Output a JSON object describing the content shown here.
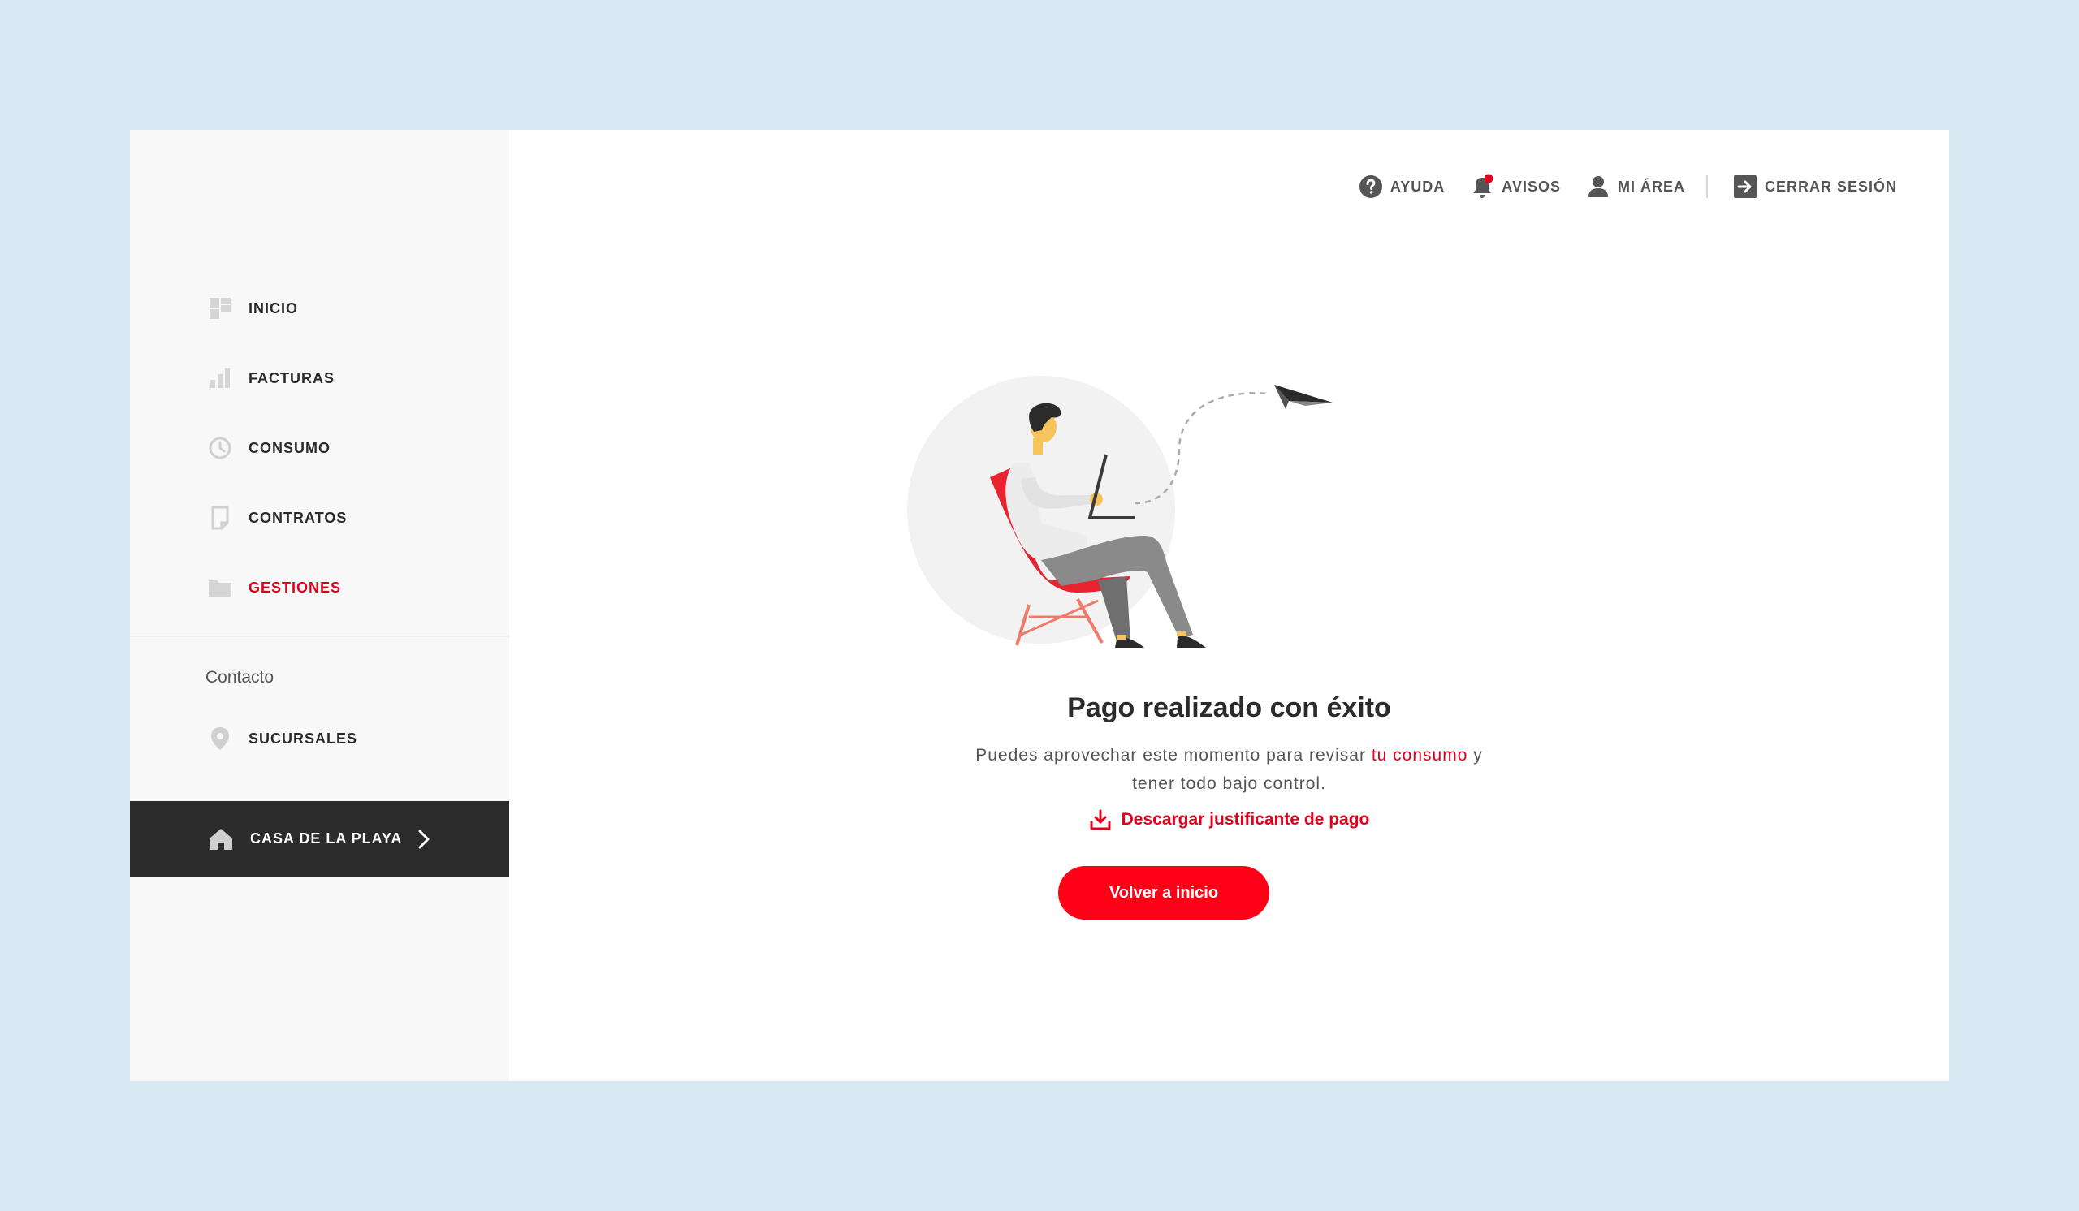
{
  "sidebar": {
    "items": [
      {
        "label": "INICIO",
        "icon": "dashboard-icon"
      },
      {
        "label": "FACTURAS",
        "icon": "bar-chart-icon"
      },
      {
        "label": "CONSUMO",
        "icon": "clock-icon"
      },
      {
        "label": "CONTRATOS",
        "icon": "document-icon"
      },
      {
        "label": "GESTIONES",
        "icon": "folder-icon",
        "active": true
      }
    ],
    "contact_title": "Contacto",
    "contact_items": [
      {
        "label": "SUCURSALES",
        "icon": "location-pin-icon"
      }
    ],
    "property": {
      "label": "CASA DE LA PLAYA",
      "icon": "home-icon"
    }
  },
  "topbar": {
    "help": "AYUDA",
    "notices": "AVISOS",
    "my_area": "MI ÁREA",
    "logout": "CERRAR SESIÓN"
  },
  "main": {
    "title": "Pago realizado con éxito",
    "desc_before": "Puedes aprovechar este momento para revisar ",
    "desc_link": "tu consumo",
    "desc_after": " y",
    "desc_line2": "tener todo bajo control.",
    "download_label": "Descargar justificante de pago",
    "button_label": "Volver a inicio"
  },
  "colors": {
    "accent": "#e2001a",
    "button": "#ff0016",
    "sidebar_bg": "#f8f8f8",
    "property_bg": "#2b2b2b",
    "page_bg": "#d9e9f3"
  }
}
